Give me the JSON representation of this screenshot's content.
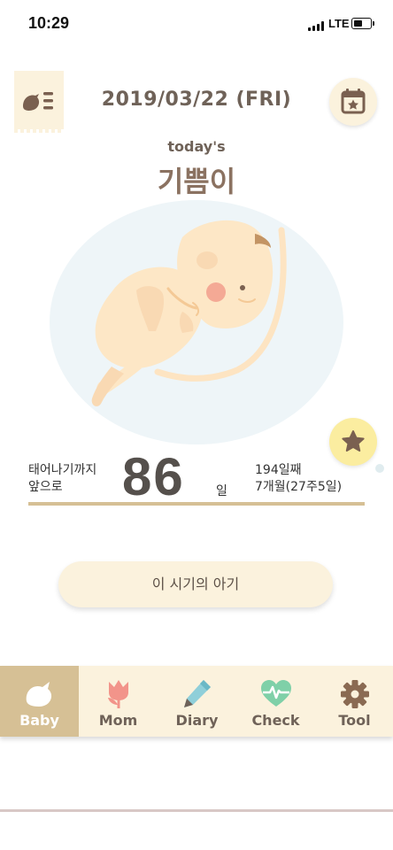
{
  "status_bar": {
    "time": "10:29",
    "network": "LTE"
  },
  "header": {
    "date": "2019/03/22 (FRI)",
    "menu_icon": "baby-list-icon",
    "calendar_icon": "calendar-star-icon"
  },
  "today": {
    "caption": "today's",
    "name": "기쁨이"
  },
  "art": {
    "subject": "fetus-illustration",
    "background": "#eef5f8"
  },
  "favorite": {
    "icon": "star-icon"
  },
  "countdown": {
    "label_line1": "태어나기까지",
    "label_line2": "앞으로",
    "days_left": "86",
    "unit": "일",
    "elapsed_line1": "194일째",
    "elapsed_line2": "7개월(27주5일)"
  },
  "stage_button": {
    "label": "이 시기의 아기"
  },
  "tabs": [
    {
      "label": "Baby",
      "icon": "bird-icon",
      "active": true
    },
    {
      "label": "Mom",
      "icon": "tulip-icon",
      "active": false
    },
    {
      "label": "Diary",
      "icon": "pencil-icon",
      "active": false
    },
    {
      "label": "Check",
      "icon": "heartbeat-icon",
      "active": false
    },
    {
      "label": "Tool",
      "icon": "gear-icon",
      "active": false
    }
  ],
  "colors": {
    "accent": "#d6c095",
    "cream": "#fbf2dd",
    "text": "#6f6258",
    "star_bg": "#fbeda0"
  }
}
